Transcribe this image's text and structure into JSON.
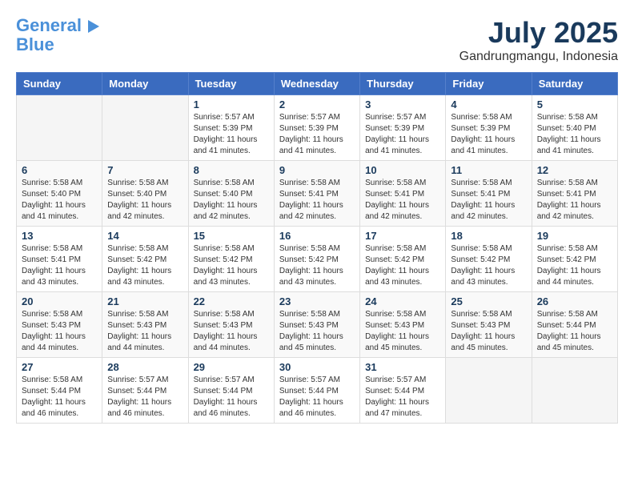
{
  "logo": {
    "line1": "General",
    "line2": "Blue"
  },
  "title": "July 2025",
  "location": "Gandrungmangu, Indonesia",
  "headers": [
    "Sunday",
    "Monday",
    "Tuesday",
    "Wednesday",
    "Thursday",
    "Friday",
    "Saturday"
  ],
  "weeks": [
    [
      {
        "day": "",
        "info": ""
      },
      {
        "day": "",
        "info": ""
      },
      {
        "day": "1",
        "info": "Sunrise: 5:57 AM\nSunset: 5:39 PM\nDaylight: 11 hours and 41 minutes."
      },
      {
        "day": "2",
        "info": "Sunrise: 5:57 AM\nSunset: 5:39 PM\nDaylight: 11 hours and 41 minutes."
      },
      {
        "day": "3",
        "info": "Sunrise: 5:57 AM\nSunset: 5:39 PM\nDaylight: 11 hours and 41 minutes."
      },
      {
        "day": "4",
        "info": "Sunrise: 5:58 AM\nSunset: 5:39 PM\nDaylight: 11 hours and 41 minutes."
      },
      {
        "day": "5",
        "info": "Sunrise: 5:58 AM\nSunset: 5:40 PM\nDaylight: 11 hours and 41 minutes."
      }
    ],
    [
      {
        "day": "6",
        "info": "Sunrise: 5:58 AM\nSunset: 5:40 PM\nDaylight: 11 hours and 41 minutes."
      },
      {
        "day": "7",
        "info": "Sunrise: 5:58 AM\nSunset: 5:40 PM\nDaylight: 11 hours and 42 minutes."
      },
      {
        "day": "8",
        "info": "Sunrise: 5:58 AM\nSunset: 5:40 PM\nDaylight: 11 hours and 42 minutes."
      },
      {
        "day": "9",
        "info": "Sunrise: 5:58 AM\nSunset: 5:41 PM\nDaylight: 11 hours and 42 minutes."
      },
      {
        "day": "10",
        "info": "Sunrise: 5:58 AM\nSunset: 5:41 PM\nDaylight: 11 hours and 42 minutes."
      },
      {
        "day": "11",
        "info": "Sunrise: 5:58 AM\nSunset: 5:41 PM\nDaylight: 11 hours and 42 minutes."
      },
      {
        "day": "12",
        "info": "Sunrise: 5:58 AM\nSunset: 5:41 PM\nDaylight: 11 hours and 42 minutes."
      }
    ],
    [
      {
        "day": "13",
        "info": "Sunrise: 5:58 AM\nSunset: 5:41 PM\nDaylight: 11 hours and 43 minutes."
      },
      {
        "day": "14",
        "info": "Sunrise: 5:58 AM\nSunset: 5:42 PM\nDaylight: 11 hours and 43 minutes."
      },
      {
        "day": "15",
        "info": "Sunrise: 5:58 AM\nSunset: 5:42 PM\nDaylight: 11 hours and 43 minutes."
      },
      {
        "day": "16",
        "info": "Sunrise: 5:58 AM\nSunset: 5:42 PM\nDaylight: 11 hours and 43 minutes."
      },
      {
        "day": "17",
        "info": "Sunrise: 5:58 AM\nSunset: 5:42 PM\nDaylight: 11 hours and 43 minutes."
      },
      {
        "day": "18",
        "info": "Sunrise: 5:58 AM\nSunset: 5:42 PM\nDaylight: 11 hours and 43 minutes."
      },
      {
        "day": "19",
        "info": "Sunrise: 5:58 AM\nSunset: 5:42 PM\nDaylight: 11 hours and 44 minutes."
      }
    ],
    [
      {
        "day": "20",
        "info": "Sunrise: 5:58 AM\nSunset: 5:43 PM\nDaylight: 11 hours and 44 minutes."
      },
      {
        "day": "21",
        "info": "Sunrise: 5:58 AM\nSunset: 5:43 PM\nDaylight: 11 hours and 44 minutes."
      },
      {
        "day": "22",
        "info": "Sunrise: 5:58 AM\nSunset: 5:43 PM\nDaylight: 11 hours and 44 minutes."
      },
      {
        "day": "23",
        "info": "Sunrise: 5:58 AM\nSunset: 5:43 PM\nDaylight: 11 hours and 45 minutes."
      },
      {
        "day": "24",
        "info": "Sunrise: 5:58 AM\nSunset: 5:43 PM\nDaylight: 11 hours and 45 minutes."
      },
      {
        "day": "25",
        "info": "Sunrise: 5:58 AM\nSunset: 5:43 PM\nDaylight: 11 hours and 45 minutes."
      },
      {
        "day": "26",
        "info": "Sunrise: 5:58 AM\nSunset: 5:44 PM\nDaylight: 11 hours and 45 minutes."
      }
    ],
    [
      {
        "day": "27",
        "info": "Sunrise: 5:58 AM\nSunset: 5:44 PM\nDaylight: 11 hours and 46 minutes."
      },
      {
        "day": "28",
        "info": "Sunrise: 5:57 AM\nSunset: 5:44 PM\nDaylight: 11 hours and 46 minutes."
      },
      {
        "day": "29",
        "info": "Sunrise: 5:57 AM\nSunset: 5:44 PM\nDaylight: 11 hours and 46 minutes."
      },
      {
        "day": "30",
        "info": "Sunrise: 5:57 AM\nSunset: 5:44 PM\nDaylight: 11 hours and 46 minutes."
      },
      {
        "day": "31",
        "info": "Sunrise: 5:57 AM\nSunset: 5:44 PM\nDaylight: 11 hours and 47 minutes."
      },
      {
        "day": "",
        "info": ""
      },
      {
        "day": "",
        "info": ""
      }
    ]
  ]
}
